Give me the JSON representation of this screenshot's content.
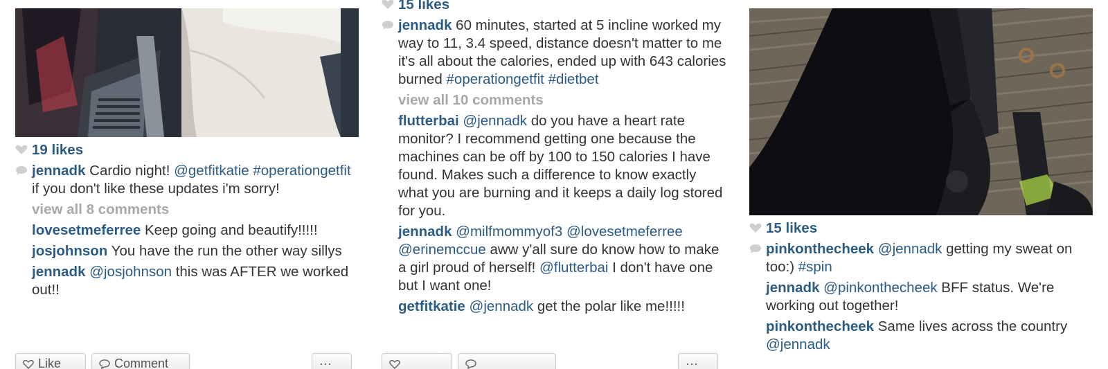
{
  "colors": {
    "username": "#2b5b84",
    "body_text": "#333333",
    "muted": "#a8a8a8",
    "icon_gray": "#cfcfcf"
  },
  "posts": [
    {
      "likes": "19 likes",
      "caption": {
        "user": "jennadk",
        "parts": [
          {
            "t": "plain",
            "v": " Cardio night! "
          },
          {
            "t": "mention",
            "v": "@getfitkatie"
          },
          {
            "t": "plain",
            "v": " "
          },
          {
            "t": "tag",
            "v": "#operationgetfit"
          },
          {
            "t": "plain",
            "v": " if you don't like these updates i'm sorry!"
          }
        ]
      },
      "view_all": "view all 8 comments",
      "comments": [
        {
          "user": "lovesetmeferree",
          "parts": [
            {
              "t": "plain",
              "v": " Keep going and beautify!!!!!"
            }
          ]
        },
        {
          "user": "josjohnson",
          "parts": [
            {
              "t": "plain",
              "v": " You have the run the other way sillys"
            }
          ]
        },
        {
          "user": "jennadk",
          "parts": [
            {
              "t": "plain",
              "v": " "
            },
            {
              "t": "mention",
              "v": "@josjohnson"
            },
            {
              "t": "plain",
              "v": " this was AFTER we worked out!!"
            }
          ]
        }
      ],
      "buttons": {
        "like": "Like",
        "comment": "Comment"
      }
    },
    {
      "likes": "15 likes",
      "caption": {
        "user": "jennadk",
        "parts": [
          {
            "t": "plain",
            "v": " 60 minutes, started at 5 incline worked my way to 11, 3.4 speed, distance doesn't matter to me it's all about the calories, ended up with 643 calories burned "
          },
          {
            "t": "tag",
            "v": "#operationgetfit"
          },
          {
            "t": "plain",
            "v": " "
          },
          {
            "t": "tag",
            "v": "#dietbet"
          }
        ]
      },
      "view_all": "view all 10 comments",
      "comments": [
        {
          "user": "flutterbai",
          "parts": [
            {
              "t": "plain",
              "v": " "
            },
            {
              "t": "mention",
              "v": "@jennadk"
            },
            {
              "t": "plain",
              "v": " do you have a heart rate monitor? I recommend getting one because the machines can be off by 100 to 150 calories I have found. Makes such a difference to know exactly what you are burning and it keeps a daily log stored for you."
            }
          ]
        },
        {
          "user": "jennadk",
          "parts": [
            {
              "t": "plain",
              "v": " "
            },
            {
              "t": "mention",
              "v": "@milfmommyof3"
            },
            {
              "t": "plain",
              "v": " "
            },
            {
              "t": "mention",
              "v": "@lovesetmeferree"
            },
            {
              "t": "plain",
              "v": " "
            },
            {
              "t": "mention",
              "v": "@erinemccue"
            },
            {
              "t": "plain",
              "v": " aww y'all sure do know how to make a girl proud of herself! "
            },
            {
              "t": "mention",
              "v": "@flutterbai"
            },
            {
              "t": "plain",
              "v": " I don't have one but I want one!"
            }
          ]
        },
        {
          "user": "getfitkatie",
          "parts": [
            {
              "t": "plain",
              "v": " "
            },
            {
              "t": "mention",
              "v": "@jennadk"
            },
            {
              "t": "plain",
              "v": " get the polar like me!!!!!"
            }
          ]
        }
      ]
    },
    {
      "likes": "15 likes",
      "caption": {
        "user": "pinkonthecheek",
        "parts": [
          {
            "t": "plain",
            "v": " "
          },
          {
            "t": "mention",
            "v": "@jennadk"
          },
          {
            "t": "plain",
            "v": " getting my sweat on too:) "
          },
          {
            "t": "tag",
            "v": "#spin"
          }
        ]
      },
      "comments": [
        {
          "user": "jennadk",
          "parts": [
            {
              "t": "plain",
              "v": " "
            },
            {
              "t": "mention",
              "v": "@pinkonthecheek"
            },
            {
              "t": "plain",
              "v": " BFF status. We're working out together!"
            }
          ]
        },
        {
          "user": "pinkonthecheek",
          "parts": [
            {
              "t": "plain",
              "v": " Same lives across the country "
            },
            {
              "t": "mention",
              "v": "@jennadk"
            }
          ]
        }
      ]
    }
  ]
}
